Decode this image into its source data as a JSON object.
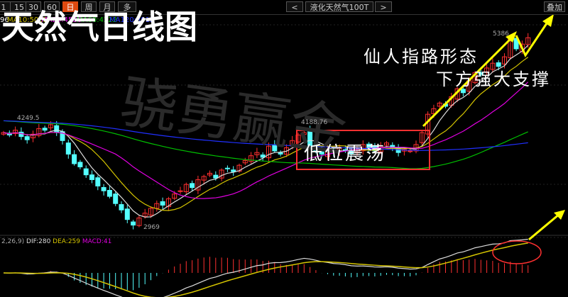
{
  "toolbar": {
    "periods": [
      "1",
      "15",
      "30",
      "60",
      "日",
      "周",
      "月",
      "多"
    ],
    "active": "日",
    "prev": "<",
    "next": ">",
    "instrument": "液化天然气100T",
    "overlay": "叠加"
  },
  "ma_labels": [
    {
      "text": "96",
      "color": "#ffffff"
    },
    {
      "text": "MA10:5083",
      "color": "#d4c400"
    },
    {
      "text": "MA20:4586",
      "color": "#e000e0"
    },
    {
      "text": "MA60:4222",
      "color": "#00c000"
    },
    {
      "text": "MA120:3912",
      "color": "#2030ff"
    }
  ],
  "macd_labels": {
    "params": "2,26,9)",
    "dif": "DIF:280",
    "dea": "DEA:259",
    "macd": "MACD:41"
  },
  "annotations": {
    "title": "天然气日线图",
    "pattern": "仙人指路形态",
    "support": "下方强大支撑",
    "range": "低位震荡",
    "watermark": "骁勇赢金"
  },
  "chart_data": {
    "type": "candlestick",
    "title": "天然气日线图",
    "price_labels": {
      "high1": "4249.5",
      "low": "2969",
      "high2": "4188.76",
      "high3": "5386"
    },
    "ylim": [
      2900,
      5450
    ],
    "closes": [
      4150,
      4120,
      4180,
      4100,
      4060,
      4130,
      4200,
      4180,
      4249,
      4150,
      4050,
      3880,
      3760,
      3720,
      3620,
      3560,
      3480,
      3420,
      3350,
      3260,
      3180,
      3060,
      2990,
      3080,
      3140,
      3200,
      3260,
      3240,
      3320,
      3380,
      3420,
      3500,
      3460,
      3560,
      3600,
      3640,
      3580,
      3680,
      3700,
      3660,
      3740,
      3800,
      3860,
      3900,
      3840,
      3980,
      3920,
      3880,
      3960,
      4050,
      4120,
      4150,
      3980,
      3920,
      3880,
      3940,
      3900,
      3960,
      3920,
      3880,
      3940,
      4000,
      3950,
      3920,
      3980,
      4020,
      3960,
      3900,
      3940,
      3920,
      4000,
      4150,
      4380,
      4450,
      4520,
      4480,
      4600,
      4700,
      4650,
      4800,
      4900,
      4880,
      4960,
      5020,
      4980,
      5100,
      5320,
      5200,
      5260,
      5340
    ],
    "ma_periods": [
      5,
      10,
      20,
      60,
      120
    ],
    "colors": {
      "up": "#ff3030",
      "down": "#54ffff",
      "ma5": "#dddddd",
      "ma10": "#d4c400",
      "ma20": "#e000e0",
      "ma60": "#00c000",
      "ma120": "#2030ff"
    }
  }
}
